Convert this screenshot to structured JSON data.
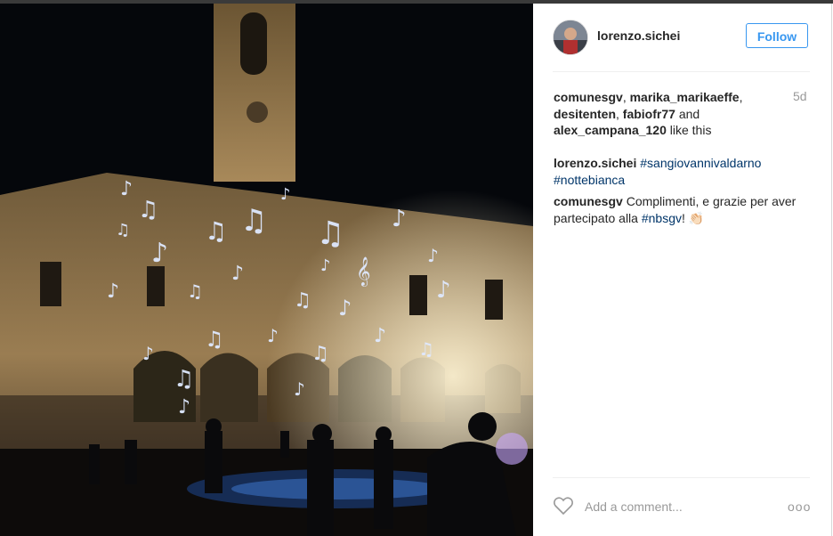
{
  "post": {
    "username": "lorenzo.sichei",
    "follow_label": "Follow",
    "time": "5d",
    "likes": {
      "users": [
        "comunesgv",
        "marika_marikaeffe",
        "desitenten",
        "fabiofr77"
      ],
      "and_text": "and",
      "last_user": "alex_campana_120",
      "suffix": "like this"
    },
    "caption": {
      "username": "lorenzo.sichei",
      "hashtags": [
        "#sangiovannivaldarno",
        "#nottebianca"
      ]
    },
    "comments": [
      {
        "username": "comunesgv",
        "text": "Complimenti, e grazie per aver partecipato alla",
        "hashtag": "#nbsgv",
        "tail": "!",
        "emoji": "👏🏻"
      }
    ],
    "add_comment_placeholder": "Add a comment...",
    "more_label": "ooo"
  },
  "icons": {
    "heart": "heart-icon",
    "more": "more-options-icon"
  },
  "colors": {
    "accent": "#3897f0",
    "hashtag": "#003569",
    "muted": "#999999"
  }
}
